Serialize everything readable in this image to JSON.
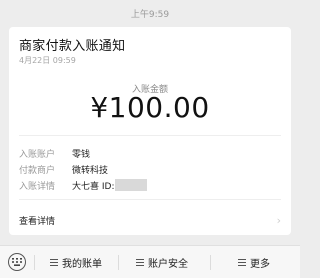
{
  "status_bar": {
    "time": "上午9:59"
  },
  "notification": {
    "title": "商家付款入账通知",
    "date": "4月22日 09:59",
    "amount_label": "入账金额",
    "amount": "¥100.00",
    "fields": [
      {
        "label": "入账账户",
        "value": "零钱"
      },
      {
        "label": "付款商户",
        "value": "微转科技"
      },
      {
        "label": "入账详情",
        "value": "大七喜 ID:"
      }
    ],
    "view_details": "查看详情"
  },
  "bottom_menu": {
    "items": [
      {
        "label": "我的账单",
        "icon": "menu-list-icon"
      },
      {
        "label": "账户安全",
        "icon": "menu-list-icon"
      },
      {
        "label": "更多",
        "icon": "menu-list-icon"
      }
    ]
  }
}
